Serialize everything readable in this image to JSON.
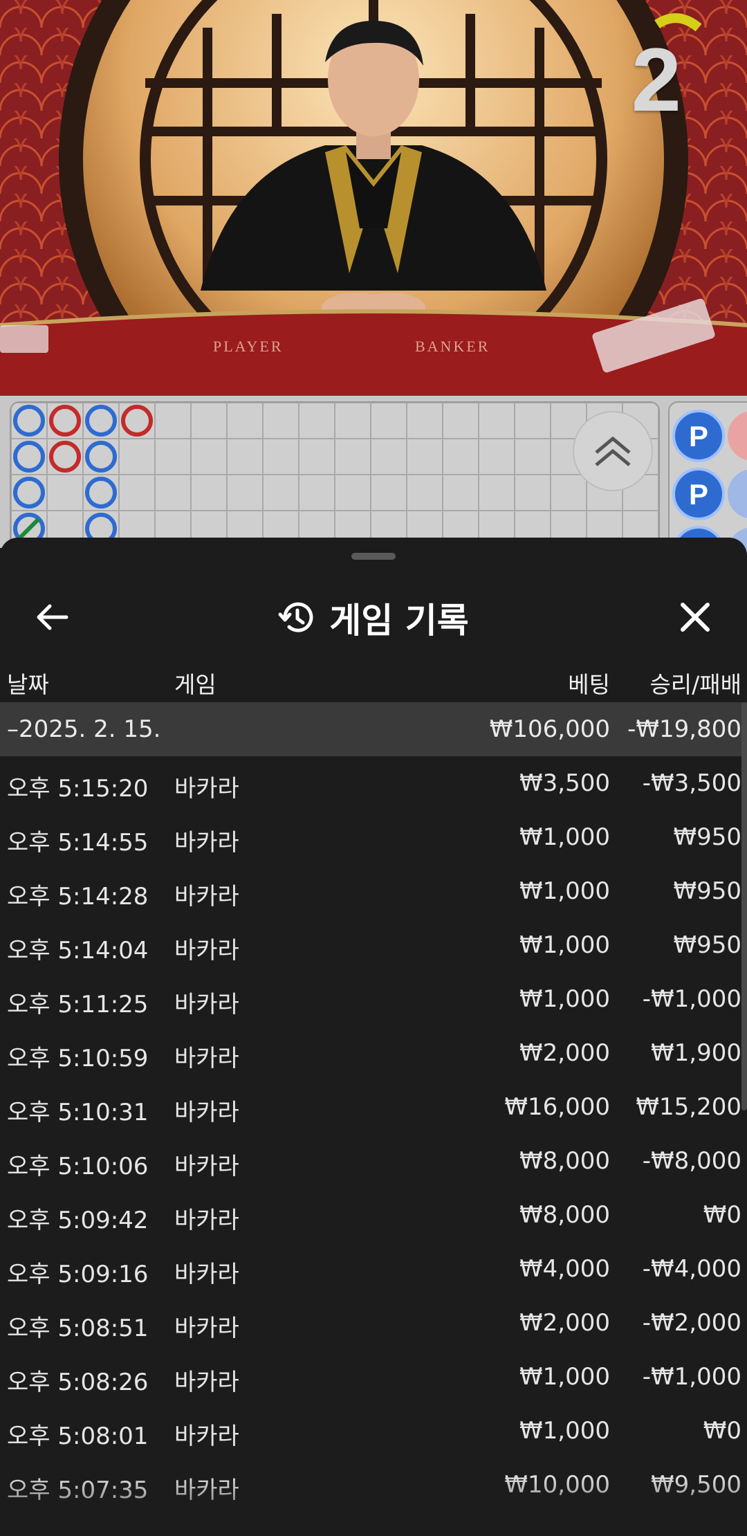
{
  "video": {
    "countdown": "2",
    "table_labels": {
      "player": "PLAYER",
      "banker": "BANKER"
    }
  },
  "roadmap": {
    "bead_rows": [
      [
        "P",
        "B",
        "P",
        "B"
      ],
      [
        "P",
        "B",
        "P",
        ""
      ],
      [
        "P",
        "",
        "P",
        ""
      ],
      [
        "T",
        "",
        "P",
        ""
      ]
    ],
    "big_road_label": "P",
    "colors": {
      "player": "#2e6bd1",
      "banker": "#c42a2a",
      "tie": "#1a8a3a"
    }
  },
  "sheet": {
    "title": "게임 기록",
    "title_icon": "history-icon",
    "back_icon": "arrow-left-icon",
    "close_icon": "close-icon",
    "columns": {
      "date": "날짜",
      "game": "게임",
      "bet": "베팅",
      "result": "승리/패배"
    },
    "summary": {
      "date": "–2025. 2. 15.",
      "bet": "₩106,000",
      "result": "-₩19,800"
    },
    "rows": [
      {
        "time": "오후 5:15:20",
        "game": "바카라",
        "bet": "₩3,500",
        "result": "-₩3,500"
      },
      {
        "time": "오후 5:14:55",
        "game": "바카라",
        "bet": "₩1,000",
        "result": "₩950"
      },
      {
        "time": "오후 5:14:28",
        "game": "바카라",
        "bet": "₩1,000",
        "result": "₩950"
      },
      {
        "time": "오후 5:14:04",
        "game": "바카라",
        "bet": "₩1,000",
        "result": "₩950"
      },
      {
        "time": "오후 5:11:25",
        "game": "바카라",
        "bet": "₩1,000",
        "result": "-₩1,000"
      },
      {
        "time": "오후 5:10:59",
        "game": "바카라",
        "bet": "₩2,000",
        "result": "₩1,900"
      },
      {
        "time": "오후 5:10:31",
        "game": "바카라",
        "bet": "₩16,000",
        "result": "₩15,200"
      },
      {
        "time": "오후 5:10:06",
        "game": "바카라",
        "bet": "₩8,000",
        "result": "-₩8,000"
      },
      {
        "time": "오후 5:09:42",
        "game": "바카라",
        "bet": "₩8,000",
        "result": "₩0"
      },
      {
        "time": "오후 5:09:16",
        "game": "바카라",
        "bet": "₩4,000",
        "result": "-₩4,000"
      },
      {
        "time": "오후 5:08:51",
        "game": "바카라",
        "bet": "₩2,000",
        "result": "-₩2,000"
      },
      {
        "time": "오후 5:08:26",
        "game": "바카라",
        "bet": "₩1,000",
        "result": "-₩1,000"
      },
      {
        "time": "오후 5:08:01",
        "game": "바카라",
        "bet": "₩1,000",
        "result": "₩0"
      },
      {
        "time": "오후 5:07:35",
        "game": "바카라",
        "bet": "₩10,000",
        "result": "₩9,500"
      }
    ]
  }
}
